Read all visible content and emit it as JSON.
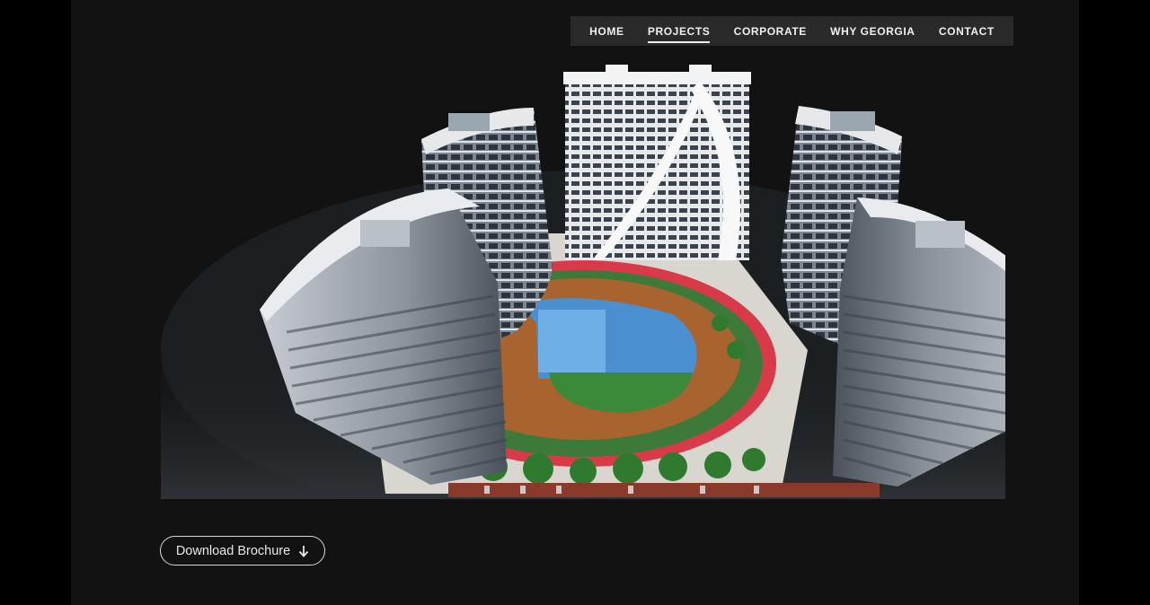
{
  "nav": {
    "items": [
      {
        "label": "HOME",
        "active": false
      },
      {
        "label": "PROJECTS",
        "active": true
      },
      {
        "label": "CORPORATE",
        "active": false
      },
      {
        "label": "WHY GEORGIA",
        "active": false
      },
      {
        "label": "CONTACT",
        "active": false
      }
    ]
  },
  "hero": {
    "image_subject": "aerial-render-residential-towers-with-pool",
    "icon": "building-render-image"
  },
  "download": {
    "label": "Download Brochure",
    "icon": "arrow-down-icon"
  },
  "colors": {
    "page_bg": "#121212",
    "outer_bg": "#000000",
    "nav_bg": "#2a2a2a",
    "nav_text": "#f0f0f0",
    "pool": "#4a90d0",
    "running_track": "#d83a4a",
    "grass": "#3a8a3a"
  }
}
